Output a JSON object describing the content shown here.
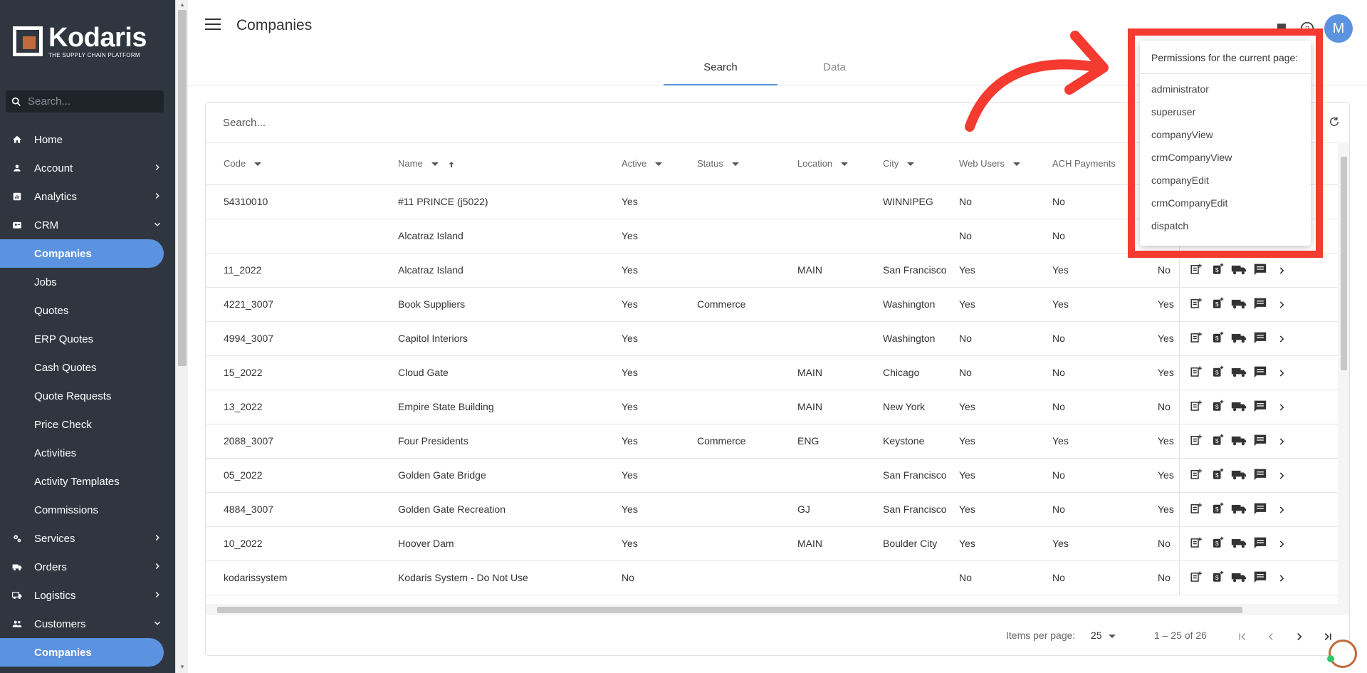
{
  "sidebar": {
    "logo_name": "Kodaris",
    "logo_tagline": "THE SUPPLY CHAIN PLATFORM",
    "search_placeholder": "Search...",
    "items": [
      {
        "label": "Home",
        "icon": "home-icon"
      },
      {
        "label": "Account",
        "icon": "person-icon",
        "chevron": "right"
      },
      {
        "label": "Analytics",
        "icon": "chart-icon",
        "chevron": "right"
      },
      {
        "label": "CRM",
        "icon": "contact-card-icon",
        "chevron": "down"
      }
    ],
    "crm_subitems": [
      "Companies",
      "Jobs",
      "Quotes",
      "ERP Quotes",
      "Cash Quotes",
      "Quote Requests",
      "Price Check",
      "Activities",
      "Activity Templates",
      "Commissions"
    ],
    "items2": [
      {
        "label": "Services",
        "icon": "gears-icon",
        "chevron": "right"
      },
      {
        "label": "Orders",
        "icon": "truck-icon",
        "chevron": "right"
      },
      {
        "label": "Logistics",
        "icon": "delivery-icon",
        "chevron": "right"
      },
      {
        "label": "Customers",
        "icon": "people-icon",
        "chevron": "down"
      }
    ],
    "customers_subitems": [
      "Companies"
    ]
  },
  "header": {
    "title": "Companies",
    "tabs": [
      "Search",
      "Data"
    ],
    "active_tab": "Search",
    "avatar_initial": "M"
  },
  "search": {
    "placeholder": "Search..."
  },
  "table": {
    "columns": [
      "Code",
      "Name",
      "Active",
      "Status",
      "Location",
      "City",
      "Web Users",
      "ACH Payments"
    ],
    "rows": [
      [
        "54310010",
        "#11 PRINCE (j5022)",
        "Yes",
        "",
        "",
        "WINNIPEG",
        "No",
        "No",
        ""
      ],
      [
        "",
        "Alcatraz Island",
        "Yes",
        "",
        "",
        "",
        "No",
        "No",
        ""
      ],
      [
        "11_2022",
        "Alcatraz Island",
        "Yes",
        "",
        "MAIN",
        "San Francisco",
        "Yes",
        "Yes",
        "No"
      ],
      [
        "4221_3007",
        "Book Suppliers",
        "Yes",
        "Commerce",
        "",
        "Washington",
        "Yes",
        "Yes",
        "Yes"
      ],
      [
        "4994_3007",
        "Capitol Interiors",
        "Yes",
        "",
        "",
        "Washington",
        "No",
        "No",
        "Yes"
      ],
      [
        "15_2022",
        "Cloud Gate",
        "Yes",
        "",
        "MAIN",
        "Chicago",
        "No",
        "No",
        "Yes"
      ],
      [
        "13_2022",
        "Empire State Building",
        "Yes",
        "",
        "MAIN",
        "New York",
        "Yes",
        "No",
        "No"
      ],
      [
        "2088_3007",
        "Four Presidents",
        "Yes",
        "Commerce",
        "ENG",
        "Keystone",
        "Yes",
        "Yes",
        "Yes"
      ],
      [
        "05_2022",
        "Golden Gate Bridge",
        "Yes",
        "",
        "",
        "San Francisco",
        "Yes",
        "No",
        "Yes"
      ],
      [
        "4884_3007",
        "Golden Gate Recreation",
        "Yes",
        "",
        "GJ",
        "San Francisco",
        "Yes",
        "No",
        "Yes"
      ],
      [
        "10_2022",
        "Hoover Dam",
        "Yes",
        "",
        "MAIN",
        "Boulder City",
        "Yes",
        "Yes",
        "No"
      ],
      [
        "kodarissystem",
        "Kodaris System - Do Not Use",
        "No",
        "",
        "",
        "",
        "No",
        "No",
        "No"
      ]
    ],
    "row_actions": [
      "add-note-icon",
      "add-payment-icon",
      "shipping-truck-icon",
      "comment-icon",
      "chevron-right-icon"
    ]
  },
  "paginator": {
    "items_per_page_label": "Items per page:",
    "items_per_page": "25",
    "range": "1 – 25 of 26"
  },
  "permissions_popup": {
    "title": "Permissions for the current page:",
    "permissions": [
      "administrator",
      "superuser",
      "companyView",
      "crmCompanyView",
      "companyEdit",
      "crmCompanyEdit",
      "dispatch"
    ]
  },
  "colors": {
    "accent": "#5b93e0",
    "sidebar_bg": "#2f3640",
    "highlight_red": "#f53a2f",
    "brand_orange": "#c06a3c"
  }
}
